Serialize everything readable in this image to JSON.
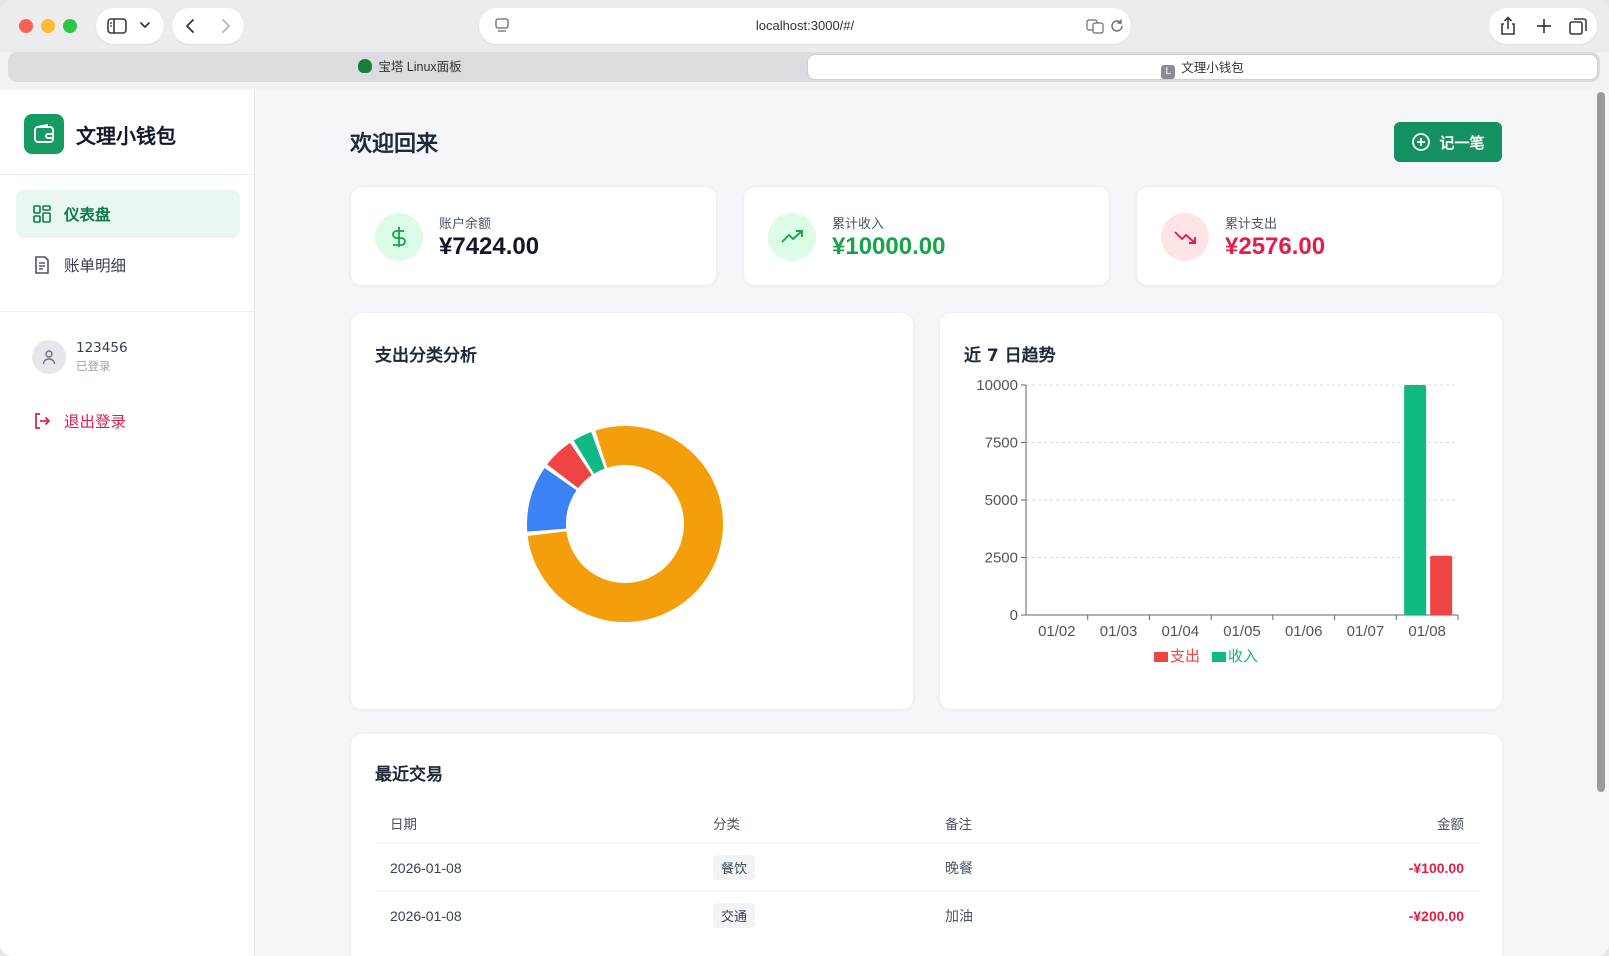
{
  "browser": {
    "url": "localhost:3000/#/",
    "tabs": [
      {
        "label": "宝塔 Linux面板",
        "active": false
      },
      {
        "label": "文理小钱包",
        "active": true,
        "favicon_letter": "L"
      }
    ]
  },
  "app": {
    "name": "文理小钱包",
    "nav": [
      {
        "label": "仪表盘",
        "icon": "dashboard-icon",
        "active": true
      },
      {
        "label": "账单明细",
        "icon": "receipt-icon",
        "active": false
      }
    ],
    "user": {
      "name": "123456",
      "status": "已登录"
    },
    "logout_label": "退出登录"
  },
  "main": {
    "title": "欢迎回来",
    "add_button": "记一笔"
  },
  "stats": [
    {
      "label": "账户余额",
      "value": "¥7424.00",
      "icon": "dollar-icon",
      "color": "#111827",
      "icon_bg": "#dcfce7",
      "icon_color": "#16a34a"
    },
    {
      "label": "累计收入",
      "value": "¥10000.00",
      "icon": "trending-up-icon",
      "color": "#16a34a",
      "icon_bg": "#dcfce7",
      "icon_color": "#16a34a"
    },
    {
      "label": "累计支出",
      "value": "¥2576.00",
      "icon": "trending-down-icon",
      "color": "#e11d48",
      "icon_bg": "#ffe4e6",
      "icon_color": "#e11d48"
    }
  ],
  "panels": {
    "pie_title": "支出分类分析",
    "bar_title": "近 7 日趋势"
  },
  "chart_data": [
    {
      "type": "pie",
      "style": "donut",
      "title": "支出分类分析",
      "slices": [
        {
          "value": 2026,
          "color": "#f59e0b"
        },
        {
          "value": 300,
          "color": "#3b82f6"
        },
        {
          "value": 150,
          "color": "#ef4444"
        },
        {
          "value": 100,
          "color": "#10b981"
        }
      ]
    },
    {
      "type": "bar",
      "title": "近 7 日趋势",
      "categories": [
        "01/02",
        "01/03",
        "01/04",
        "01/05",
        "01/06",
        "01/07",
        "01/08"
      ],
      "series": [
        {
          "name": "收入",
          "color": "#10b981",
          "values": [
            0,
            0,
            0,
            0,
            0,
            0,
            10000
          ]
        },
        {
          "name": "支出",
          "color": "#ef4444",
          "values": [
            0,
            0,
            0,
            0,
            0,
            0,
            2576
          ]
        }
      ],
      "yticks": [
        0,
        2500,
        5000,
        7500,
        10000
      ],
      "ylim": [
        0,
        10000
      ],
      "grid": true,
      "legend": [
        {
          "name": "支出",
          "color": "#ef4444"
        },
        {
          "name": "收入",
          "color": "#10b981"
        }
      ],
      "legend_position": "bottom"
    }
  ],
  "transactions": {
    "title": "最近交易",
    "columns": [
      "日期",
      "分类",
      "备注",
      "金额"
    ],
    "rows": [
      {
        "date": "2026-01-08",
        "category": "餐饮",
        "note": "晚餐",
        "amount": "-¥100.00"
      },
      {
        "date": "2026-01-08",
        "category": "交通",
        "note": "加油",
        "amount": "-¥200.00"
      }
    ]
  }
}
